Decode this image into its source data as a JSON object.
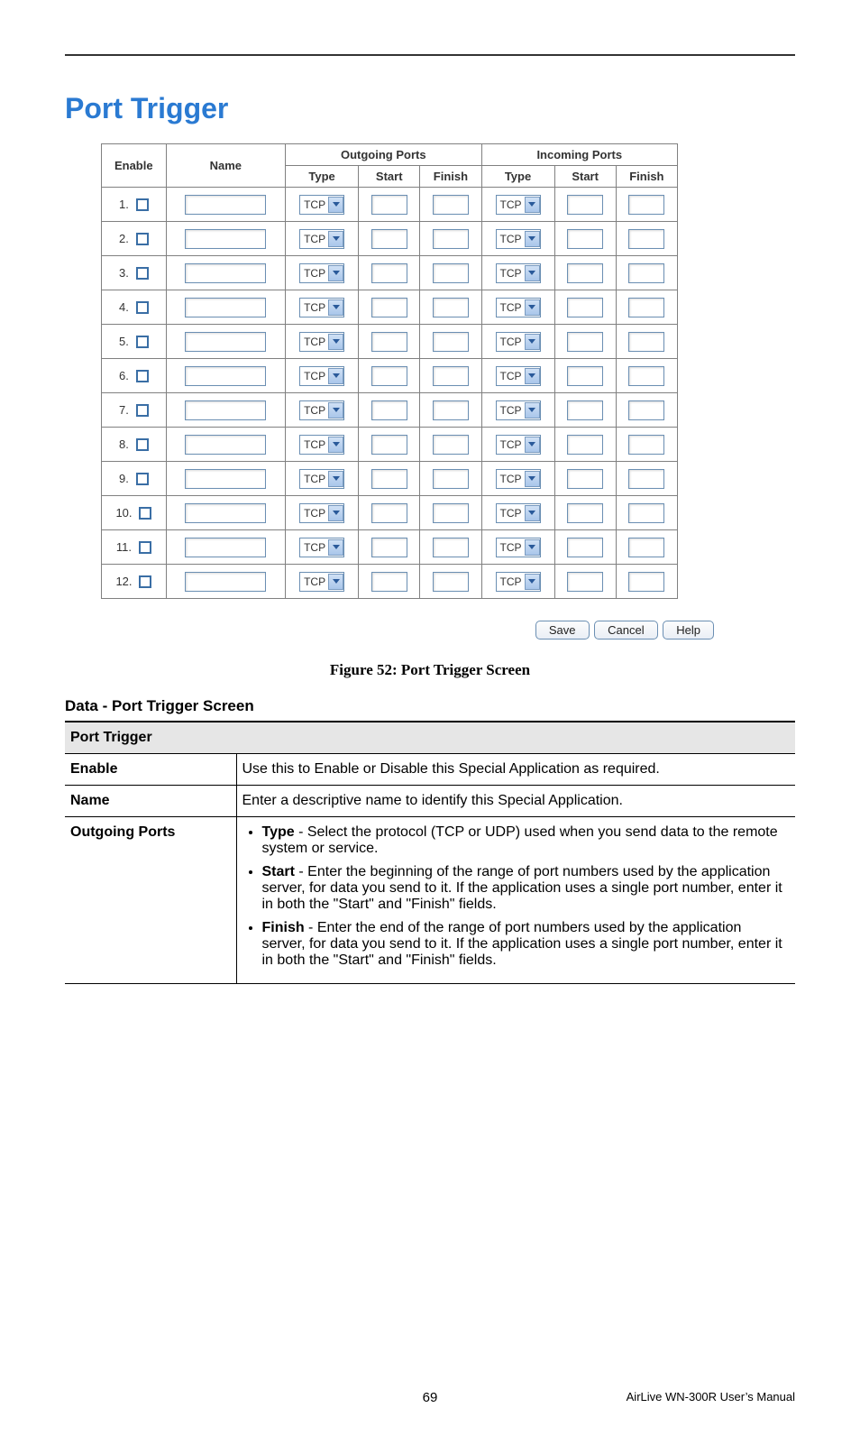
{
  "heading": "Port Trigger",
  "figure_caption": "Figure 52: Port Trigger Screen",
  "section_title": "Data - Port Trigger Screen",
  "table": {
    "group_out": "Outgoing Ports",
    "group_in": "Incoming Ports",
    "cols": {
      "enable": "Enable",
      "name": "Name",
      "type": "Type",
      "start": "Start",
      "finish": "Finish"
    },
    "row_count": 12,
    "type_value": "TCP"
  },
  "buttons": {
    "save": "Save",
    "cancel": "Cancel",
    "help": "Help"
  },
  "desc": {
    "header": "Port Trigger",
    "rows": {
      "enable": {
        "k": "Enable",
        "v": "Use this to Enable or Disable this Special Application as required."
      },
      "name": {
        "k": "Name",
        "v": "Enter a descriptive name to identify this Special Application."
      },
      "outgoing": {
        "k": "Outgoing Ports",
        "bullets": {
          "type": {
            "term": "Type",
            "text": " - Select the protocol (TCP or UDP) used when you send data to the remote system or service."
          },
          "start": {
            "term": "Start",
            "text": " - Enter the beginning of the range of port numbers used by the application server, for data you send to it. If the application uses a single port number, enter it in both the \"Start\" and \"Finish\" fields."
          },
          "finish": {
            "term": "Finish",
            "text": " - Enter the end of the range of port numbers used by the application server, for data you send to it. If the application uses a single port number, enter it in both the \"Start\" and \"Finish\" fields."
          }
        }
      }
    }
  },
  "footer": {
    "page": "69",
    "product": "AirLive WN-300R User’s Manual"
  }
}
